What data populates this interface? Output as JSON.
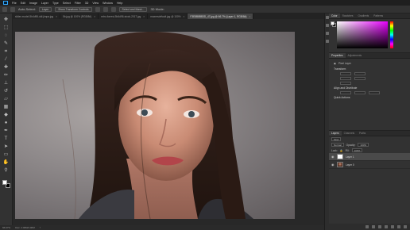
{
  "menu": [
    "Ps",
    "File",
    "Edit",
    "Image",
    "Layer",
    "Type",
    "Select",
    "Filter",
    "3D",
    "View",
    "Window",
    "Help"
  ],
  "options_bar": {
    "auto_select": "Auto-Select:",
    "layer_dropdown": "Layer",
    "show_transform": "Show Transform Controls",
    "select_and_mask": "Select and Mask...",
    "three_d_mode": "3D Mode:"
  },
  "doc_tabs": [
    {
      "label": "slider-model-5b4d96-ddl-jimpa.jpg",
      "active": false
    },
    {
      "label": "5b.jpg @ 100% (RGB/8#)",
      "active": false
    },
    {
      "label": "retro-forrest-5b4d96-stock-2017.jpg",
      "active": false
    },
    {
      "label": "maxresdefault.jpg @ 100%",
      "active": false
    },
    {
      "label": "F3E8B8BB3D_47.jpg @ 66.7% (Layer 1, RGB/8#)",
      "active": true
    }
  ],
  "tools": [
    "move-icon",
    "marquee-icon",
    "lasso-icon",
    "quick-select-icon",
    "crop-icon",
    "eyedropper-icon",
    "healing-icon",
    "brush-icon",
    "stamp-icon",
    "history-brush-icon",
    "eraser-icon",
    "gradient-icon",
    "blur-icon",
    "dodge-icon",
    "pen-icon",
    "type-icon",
    "path-select-icon",
    "shape-icon",
    "hand-icon",
    "zoom-icon"
  ],
  "status": {
    "zoom": "66.67%",
    "doc_size": "Doc: 2.00M/4.00M"
  },
  "color_panel": {
    "tabs": [
      "Color",
      "Swatches",
      "Gradients",
      "Patterns"
    ],
    "hue_color": "#e800ff"
  },
  "properties": {
    "tabs": [
      "Properties",
      "Adjustments"
    ],
    "kind": "Pixel Layer",
    "transform": "Transform",
    "align": "Align and Distribute",
    "quick_actions": "Quick Actions"
  },
  "layers": {
    "tabs": [
      "Layers",
      "Channels",
      "Paths"
    ],
    "kind": "Kind",
    "blend": "Normal",
    "opacity_label": "Opacity:",
    "opacity": "100%",
    "lock_label": "Lock:",
    "fill_label": "Fill:",
    "fill": "100%",
    "items": [
      {
        "name": "Layer 1",
        "thumb": "white",
        "selected": true
      },
      {
        "name": "Layer 0",
        "thumb": "photo",
        "selected": false
      }
    ]
  }
}
